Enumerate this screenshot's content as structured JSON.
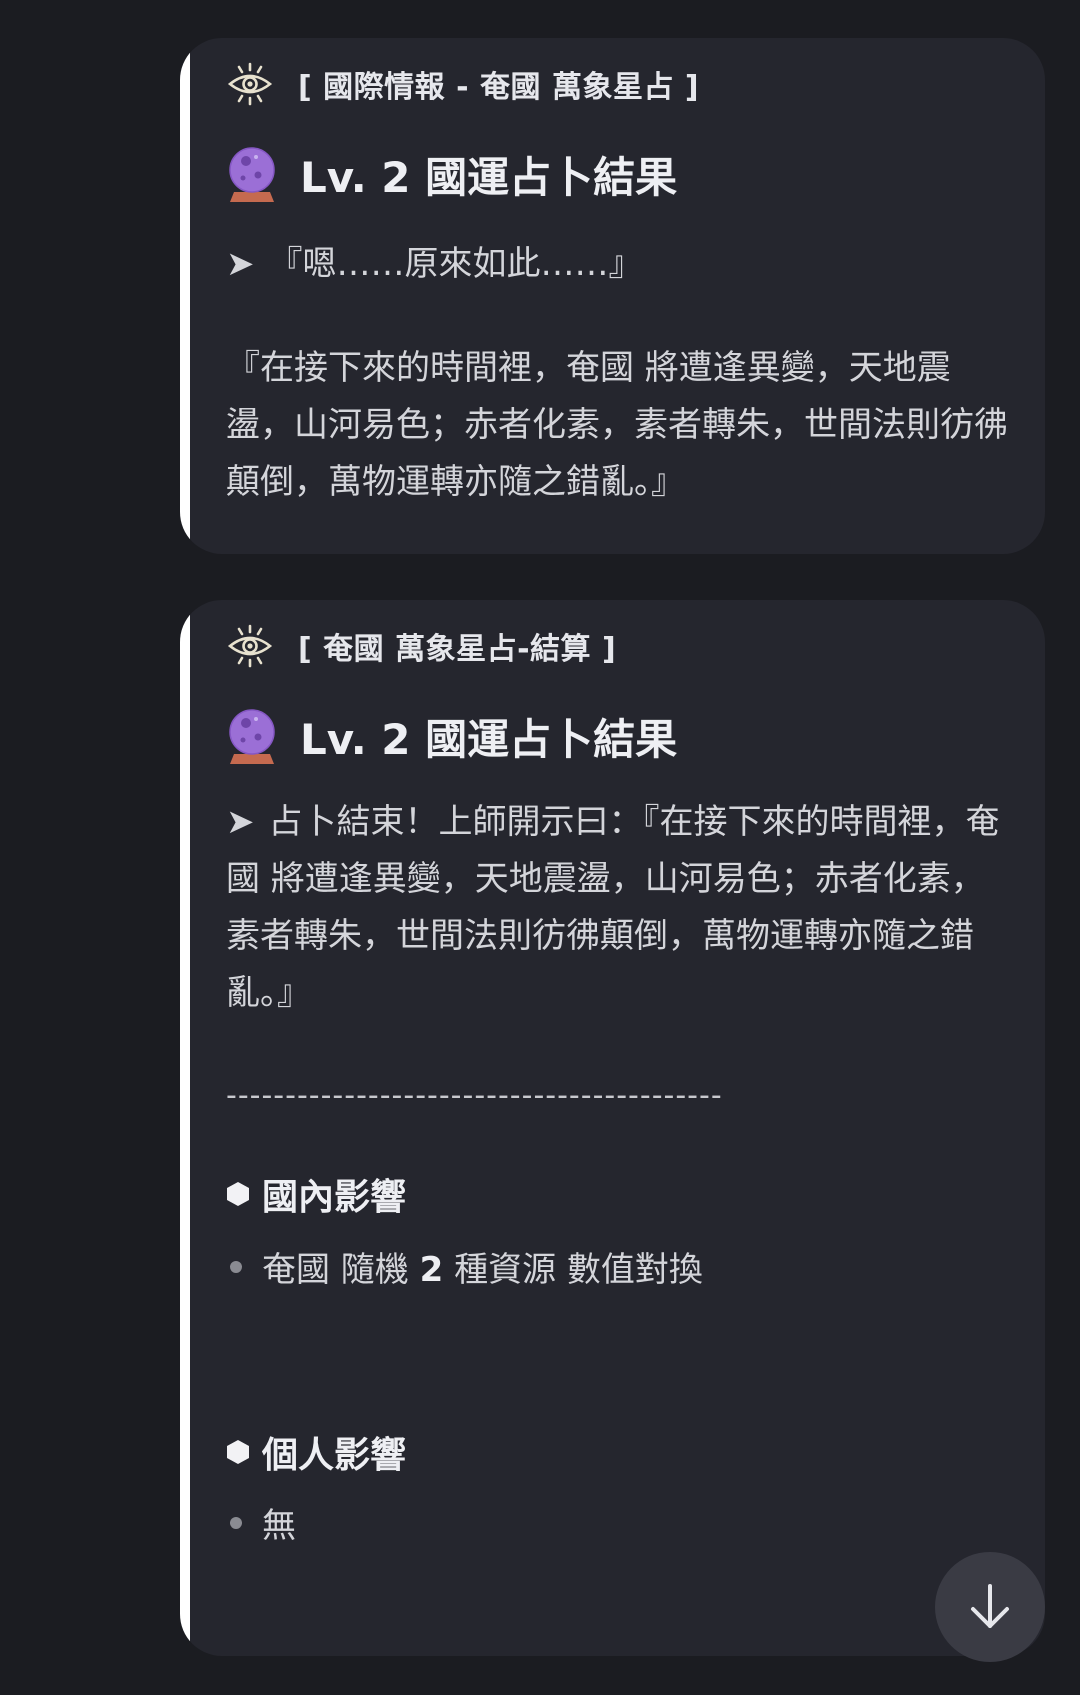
{
  "cards": [
    {
      "header_icon": "eye-icon",
      "header_label": "[ 國際情報 - 奄國 萬象星占 ]",
      "title_icon": "crystal-ball-icon",
      "title": "Lv. 2 國運占卜結果",
      "arrow_icon": "arrow-right-icon",
      "lead_text": "『嗯……原來如此……』",
      "body_text": "『在接下來的時間裡，奄國 將遭逢異變，天地震盪，山河易色；赤者化素，素者轉朱，世間法則彷彿顛倒，萬物運轉亦隨之錯亂。』"
    },
    {
      "header_icon": "eye-icon",
      "header_label": "[ 奄國 萬象星占-結算 ]",
      "title_icon": "crystal-ball-icon",
      "title": "Lv. 2 國運占卜結果",
      "arrow_icon": "arrow-right-icon",
      "body_text": "占卜結束！上師開示曰：『在接下來的時間裡，奄國 將遭逢異變，天地震盪，山河易色；赤者化素，素者轉朱，世間法則彷彿顛倒，萬物運轉亦隨之錯亂。』",
      "divider": "------------------------------------------",
      "sections": [
        {
          "icon": "hexagon-icon",
          "heading": "國內影響",
          "items": [
            {
              "prefix": "奄國 隨機 ",
              "bold": "2",
              "suffix": " 種資源 數值對換"
            }
          ]
        },
        {
          "icon": "hexagon-icon",
          "heading": "個人影響",
          "items": [
            {
              "text": "無"
            }
          ]
        }
      ]
    }
  ],
  "scroll_button": {
    "icon": "arrow-down-icon"
  },
  "colors": {
    "background": "#1b1c21",
    "card": "#25262e",
    "edge": "#ffffff",
    "crystal_ball": "#9b6fd6",
    "eye_icon": "#e8e2cf"
  }
}
